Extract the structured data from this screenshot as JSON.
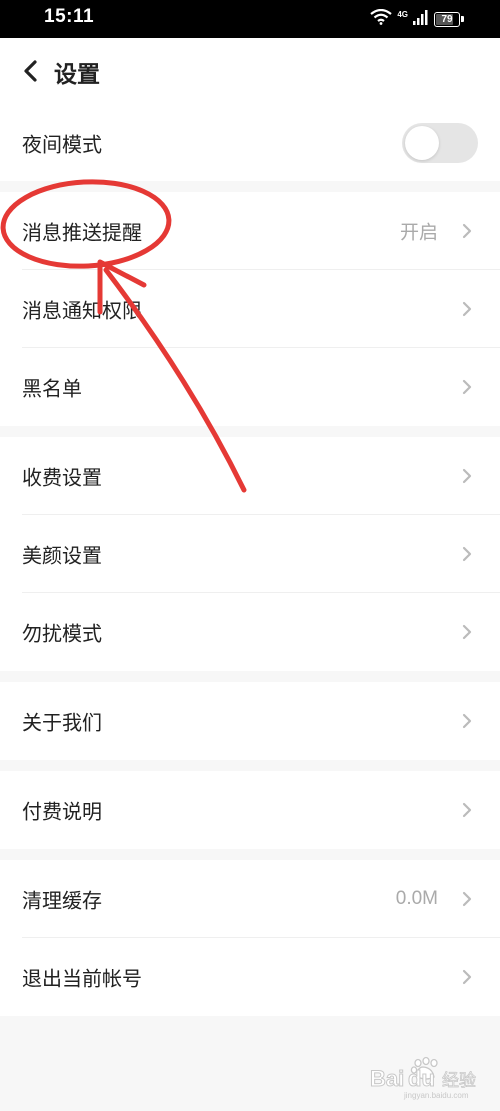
{
  "status_bar": {
    "time": "15:11",
    "network": "4G",
    "battery": "79",
    "battery_level": 0.79
  },
  "header": {
    "title": "设置"
  },
  "settings": {
    "night_mode": {
      "label": "夜间模式",
      "enabled": false
    },
    "push": {
      "label": "消息推送提醒",
      "value": "开启"
    },
    "notify_permission": {
      "label": "消息通知权限"
    },
    "blacklist": {
      "label": "黑名单"
    },
    "fee_settings": {
      "label": "收费设置"
    },
    "beauty_settings": {
      "label": "美颜设置"
    },
    "dnd_mode": {
      "label": "勿扰模式"
    },
    "about": {
      "label": "关于我们"
    },
    "payment_info": {
      "label": "付费说明"
    },
    "clear_cache": {
      "label": "清理缓存",
      "value": "0.0M"
    },
    "logout": {
      "label": "退出当前帐号"
    }
  },
  "colors": {
    "annotation": "#e53935",
    "toggle_off": "#e5e5e5"
  },
  "watermark": {
    "brand": "Bai",
    "brand2": "du",
    "cn": "经验",
    "url": "jingyan.baidu.com"
  }
}
